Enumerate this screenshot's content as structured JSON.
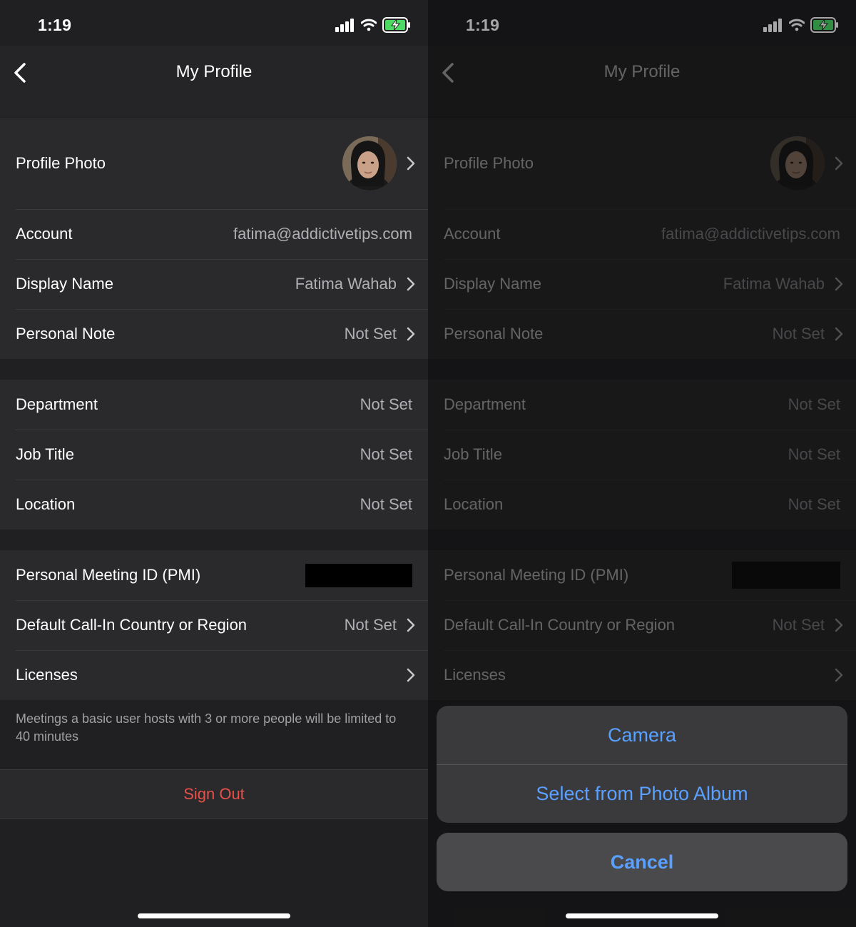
{
  "status": {
    "time": "1:19"
  },
  "nav": {
    "title": "My Profile"
  },
  "profile_photo": {
    "label": "Profile Photo"
  },
  "group1": [
    {
      "label": "Account",
      "value": "fatima@addictivetips.com",
      "chevron": false
    },
    {
      "label": "Display Name",
      "value": "Fatima Wahab",
      "chevron": true
    },
    {
      "label": "Personal Note",
      "value": "Not Set",
      "chevron": true
    }
  ],
  "group2": [
    {
      "label": "Department",
      "value": "Not Set"
    },
    {
      "label": "Job Title",
      "value": "Not Set"
    },
    {
      "label": "Location",
      "value": "Not Set"
    }
  ],
  "group3": [
    {
      "label": "Personal Meeting ID (PMI)",
      "value": ""
    },
    {
      "label": "Default Call-In Country or Region",
      "value": "Not Set"
    },
    {
      "label": "Licenses",
      "value": ""
    }
  ],
  "note": "Meetings a basic user hosts with 3 or more people will be limited to 40 minutes",
  "sign_out": "Sign Out",
  "action_sheet": {
    "camera": "Camera",
    "album": "Select from Photo Album",
    "cancel": "Cancel"
  },
  "colors": {
    "accent_blue": "#5aa0ff",
    "danger_red": "#e8504a",
    "battery_green": "#4cd964"
  }
}
